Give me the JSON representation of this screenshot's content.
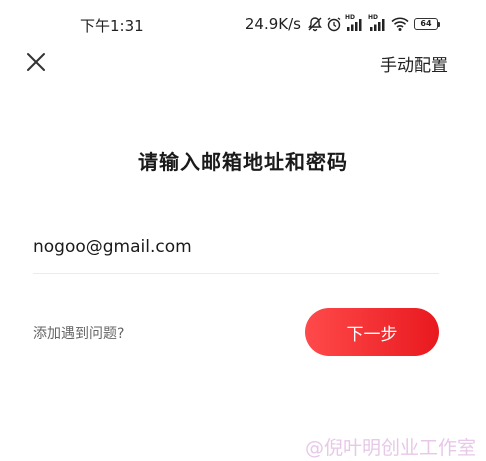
{
  "status_bar": {
    "time": "下午1:31",
    "network_speed": "24.9K/s",
    "battery": "64",
    "hd_label": "HD",
    "icons": [
      "mute-icon",
      "alarm-icon",
      "signal-icon",
      "signal-icon",
      "wifi-icon",
      "battery-icon"
    ]
  },
  "header": {
    "close_icon": "close-icon",
    "manual_config": "手动配置"
  },
  "main": {
    "title": "请输入邮箱地址和密码",
    "email_value": "nogoo@gmail.com",
    "help_link": "添加遇到问题?",
    "next_button": "下一步"
  },
  "watermark": "@倪叶明创业工作室",
  "colors": {
    "accent": "#ef2b2f",
    "watermark": "#e7c8e8"
  }
}
